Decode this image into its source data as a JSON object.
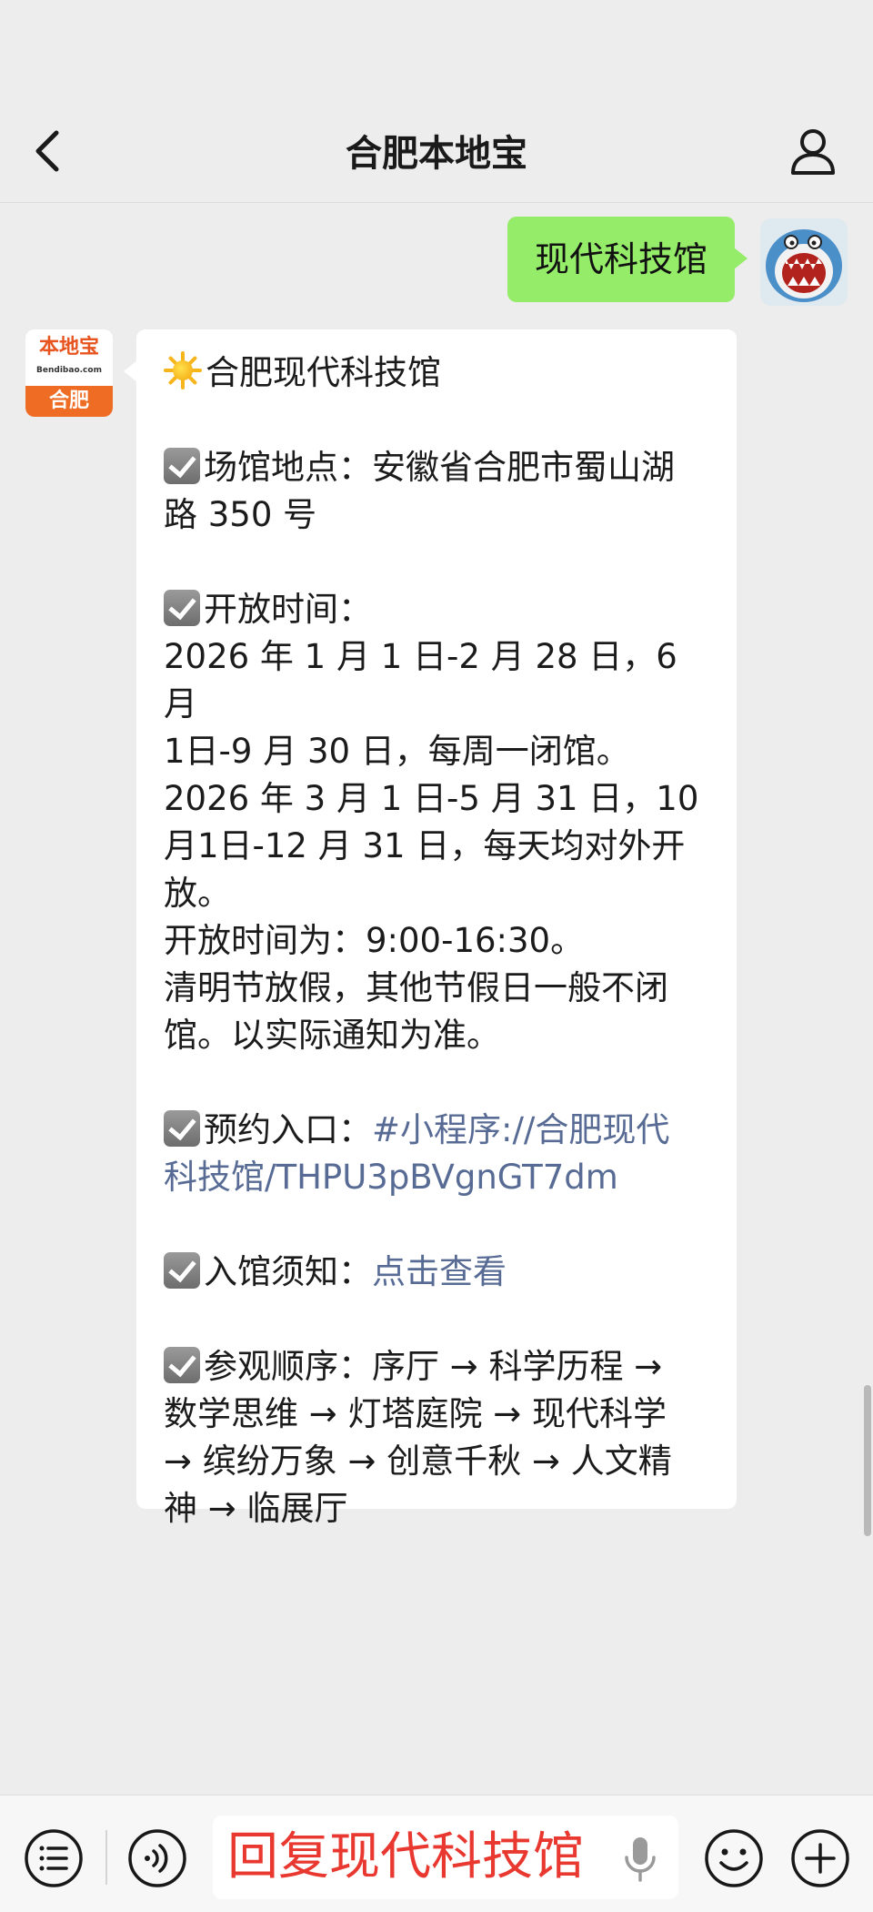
{
  "header": {
    "title": "合肥本地宝"
  },
  "outgoing": {
    "text": "现代科技馆"
  },
  "bot": {
    "avatar_brand": "本地宝",
    "avatar_sub": "Bendibao.com",
    "avatar_city": "合肥"
  },
  "message": {
    "title": "合肥现代科技馆",
    "venue_line1": "场馆地点：安徽省合肥市蜀山湖",
    "venue_line2": "路 350 号",
    "hours_heading": "开放时间：",
    "hours_lines": [
      "2026 年 1 月 1 日-2 月 28 日，6 月",
      "1日-9 月 30 日，每周一闭馆。",
      "2026 年 3 月 1 日-5 月 31 日，10",
      "月1日-12 月 31 日，每天均对外开",
      "放。",
      "开放时间为：9:00-16:30。",
      "清明节放假，其他节假日一般不闭",
      "馆。以实际通知为准。"
    ],
    "booking_label": "预约入口：",
    "booking_link_1": "#小程序://合肥现代",
    "booking_link_2": "科技馆/THPU3pBVgnGT7dm",
    "notice_label": "入馆须知：",
    "notice_link": "点击查看",
    "order_lines": [
      "参观顺序：序厅 → 科学历程 →",
      "数学思维 → 灯塔庭院 → 现代科学",
      "→ 缤纷万象 → 创意千秋 → 人文精",
      "神 → 临展厅"
    ]
  },
  "input": {
    "text": "回复现代科技馆"
  },
  "colors": {
    "outgoing_bubble": "#95ec69",
    "link": "#576b95",
    "input_text": "#e8382f",
    "brand_orange": "#ef6c25"
  }
}
